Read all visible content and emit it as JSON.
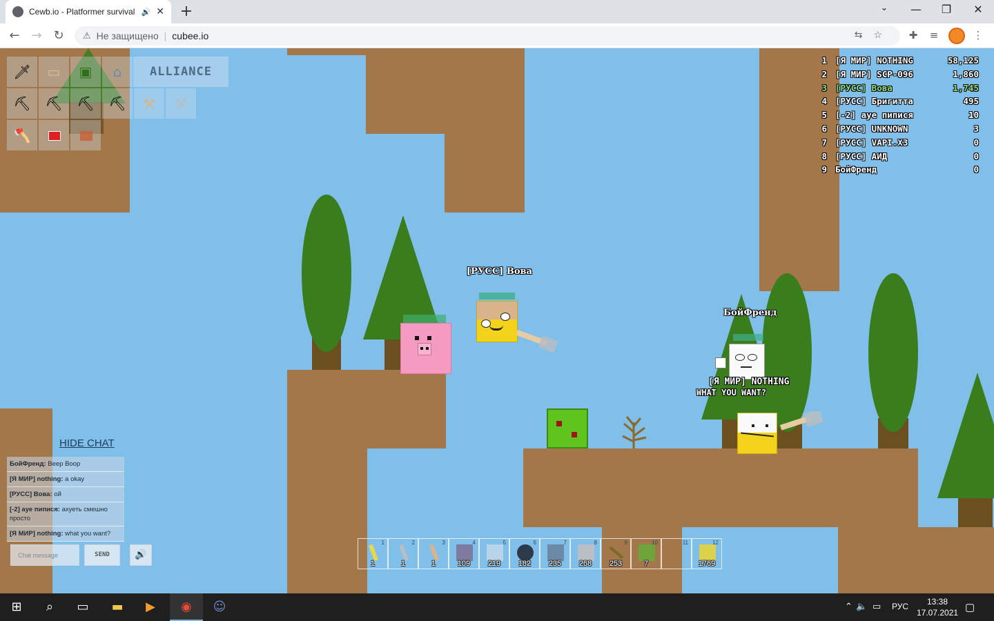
{
  "browser": {
    "tab_title": "Cewb.io - Platformer survival",
    "audio_icon": "speaker-icon",
    "tab_close": "✕",
    "new_tab": "+",
    "security_label": "Не защищено",
    "url": "cubee.io",
    "window_controls": [
      "—",
      "❐",
      "✕"
    ]
  },
  "game": {
    "alliance_label": "ALLIANCE",
    "inventory": [
      {
        "icon": "sword-icon"
      },
      {
        "icon": "plank-icon"
      },
      {
        "icon": "door-icon"
      },
      {
        "icon": "furnace-icon"
      },
      {
        "icon": "pickaxe-icon"
      },
      {
        "icon": "pickaxe-icon"
      },
      {
        "icon": "pickaxe-icon"
      },
      {
        "icon": "pickaxe-icon"
      },
      {
        "icon": "axe-icon"
      },
      {
        "icon": "health-potion-icon"
      },
      {
        "icon": "potion-icon"
      },
      {
        "icon": "hammer-icon"
      },
      {
        "icon": "hammer-icon"
      }
    ],
    "leaderboard": [
      {
        "rank": "1",
        "name": "[Я МИР] NOTHING",
        "score": "58,125"
      },
      {
        "rank": "2",
        "name": "[Я МИР] SCP-096",
        "score": "1,860"
      },
      {
        "rank": "3",
        "name": "[РУСС] Вова",
        "score": "1,745",
        "me": true
      },
      {
        "rank": "4",
        "name": "[РУСС] Бригитта",
        "score": "495"
      },
      {
        "rank": "5",
        "name": "[-2] ауе пипися",
        "score": "10"
      },
      {
        "rank": "6",
        "name": "[РУСС] UNKNOWN",
        "score": "3"
      },
      {
        "rank": "7",
        "name": "[РУСС] VAPI.X3",
        "score": "0"
      },
      {
        "rank": "8",
        "name": "[РУСС] АИД",
        "score": "0"
      },
      {
        "rank": "9",
        "name": "БойФренд",
        "score": "0"
      }
    ],
    "players": {
      "vova_name": "[РУСС] Вова",
      "boyfriend_name": "БойФренд",
      "nothing_name": "[Я МИР] NOTHING",
      "nothing_chat": "WHAT YOU WANT?"
    },
    "chat": {
      "hide_label": "HIDE CHAT",
      "messages": [
        {
          "who": "БойФренд:",
          "text": "Beep Boop"
        },
        {
          "who": "[Я МИР] nothing:",
          "text": "a okay"
        },
        {
          "who": "[РУСС] Вова:",
          "text": "ой"
        },
        {
          "who": "[-2] ауе пипися:",
          "text": "ахуеть смешно просто"
        },
        {
          "who": "[Я МИР] nothing:",
          "text": "what you want?"
        }
      ],
      "input_placeholder": "Chat message",
      "send_label": "SEND",
      "sound_icon": "speaker-icon"
    },
    "hotbar": [
      {
        "num": "1",
        "count": "1",
        "item": "sword",
        "color": "#e8d84a"
      },
      {
        "num": "2",
        "count": "1",
        "item": "pickaxe",
        "color": "#b9bdc2"
      },
      {
        "num": "3",
        "count": "1",
        "item": "pickaxe",
        "color": "#d9b48a"
      },
      {
        "num": "4",
        "count": "109",
        "item": "stone",
        "color": "#7e7aa0"
      },
      {
        "num": "5",
        "count": "219",
        "item": "ice",
        "color": "#b9d4ea"
      },
      {
        "num": "6",
        "count": "182",
        "item": "coal",
        "color": "#2d3a4a"
      },
      {
        "num": "7",
        "count": "235",
        "item": "iron",
        "color": "#6b8aa6"
      },
      {
        "num": "8",
        "count": "268",
        "item": "gravel",
        "color": "#b9bfc4"
      },
      {
        "num": "9",
        "count": "253",
        "item": "stick",
        "color": "#7a6a2a"
      },
      {
        "num": "10",
        "count": "7",
        "item": "leaf",
        "color": "#6fa33c"
      },
      {
        "num": "11",
        "count": "",
        "item": "empty",
        "color": ""
      },
      {
        "num": "12",
        "count": "1769",
        "item": "sand",
        "color": "#dcd14a"
      }
    ]
  },
  "taskbar": {
    "lang": "РУС",
    "time": "13:38",
    "date": "17.07.2021"
  }
}
